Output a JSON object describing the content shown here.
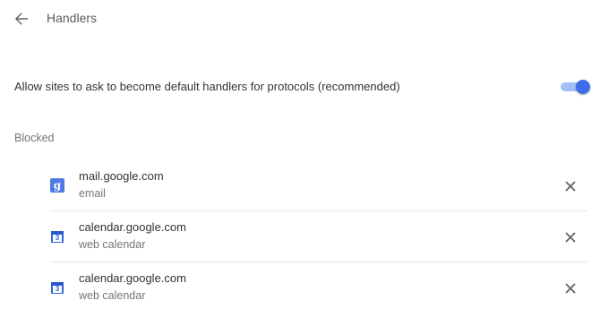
{
  "header": {
    "title": "Handlers",
    "back_icon": "arrow-left-icon"
  },
  "settings": {
    "allow_label": "Allow sites to ask to become default handlers for protocols (recommended)",
    "allow_enabled": true,
    "accent_color": "#3e6ce8"
  },
  "blocked": {
    "label": "Blocked",
    "items": [
      {
        "site": "mail.google.com",
        "protocol": "email",
        "icon": "gmail-icon",
        "icon_glyph": "g",
        "remove_icon": "close-icon"
      },
      {
        "site": "calendar.google.com",
        "protocol": "web calendar",
        "icon": "google-calendar-icon",
        "icon_glyph": "3",
        "remove_icon": "close-icon"
      },
      {
        "site": "calendar.google.com",
        "protocol": "web calendar",
        "icon": "google-calendar-icon",
        "icon_glyph": "3",
        "remove_icon": "close-icon"
      }
    ]
  }
}
